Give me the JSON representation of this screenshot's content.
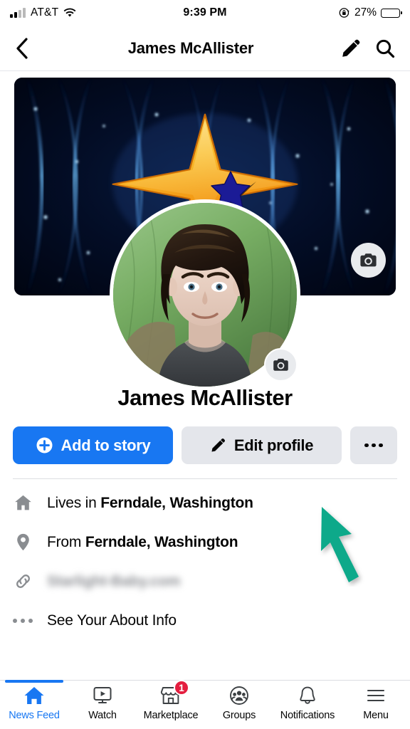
{
  "status_bar": {
    "carrier": "AT&T",
    "time": "9:39 PM",
    "battery_percent": "27%",
    "battery_level": 27,
    "signal_icon": "signal-bars-icon",
    "wifi_icon": "wifi-icon",
    "rotation_lock_icon": "rotation-lock-icon",
    "battery_icon": "battery-icon"
  },
  "header": {
    "title": "James McAllister",
    "back_icon": "chevron-left-icon",
    "edit_icon": "pencil-icon",
    "search_icon": "search-icon"
  },
  "cover": {
    "camera_icon": "camera-icon",
    "alt": "Dark blue starfield cover photo with gold diamond star logo",
    "logo_gold": "#f7a823",
    "logo_star_blue": "#1a1a8c",
    "bg_color": "#000814"
  },
  "avatar": {
    "camera_icon": "camera-icon",
    "alt": "Profile photo of a person with dark hair in front of a green background"
  },
  "profile": {
    "name": "James McAllister"
  },
  "actions": {
    "add_to_story": {
      "label": "Add to story",
      "icon": "plus-circle-icon",
      "color": "#1877f2"
    },
    "edit_profile": {
      "label": "Edit profile",
      "icon": "pencil-icon",
      "color": "#e4e6eb"
    },
    "more": {
      "label": "",
      "icon": "ellipsis-icon",
      "color": "#e4e6eb"
    }
  },
  "info_rows": [
    {
      "icon": "home-icon",
      "lead": "Lives in ",
      "value": "Ferndale, Washington",
      "redacted": false
    },
    {
      "icon": "location-pin-icon",
      "lead": "From ",
      "value": "Ferndale, Washington",
      "redacted": false
    },
    {
      "icon": "link-icon",
      "lead": "",
      "value": "Starlight-Baby.com",
      "redacted": true
    },
    {
      "icon": "ellipsis-icon",
      "lead": "",
      "value": "See Your About Info",
      "redacted": false
    }
  ],
  "bottom_nav": {
    "active_index": 0,
    "items": [
      {
        "label": "News Feed",
        "icon": "home-icon",
        "badge": ""
      },
      {
        "label": "Watch",
        "icon": "video-play-icon",
        "badge": ""
      },
      {
        "label": "Marketplace",
        "icon": "storefront-icon",
        "badge": "1"
      },
      {
        "label": "Groups",
        "icon": "groups-icon",
        "badge": ""
      },
      {
        "label": "Notifications",
        "icon": "bell-icon",
        "badge": ""
      },
      {
        "label": "Menu",
        "icon": "hamburger-menu-icon",
        "badge": ""
      }
    ]
  },
  "annotation": {
    "cursor_icon": "arrow-cursor",
    "color": "#0aa98a"
  }
}
